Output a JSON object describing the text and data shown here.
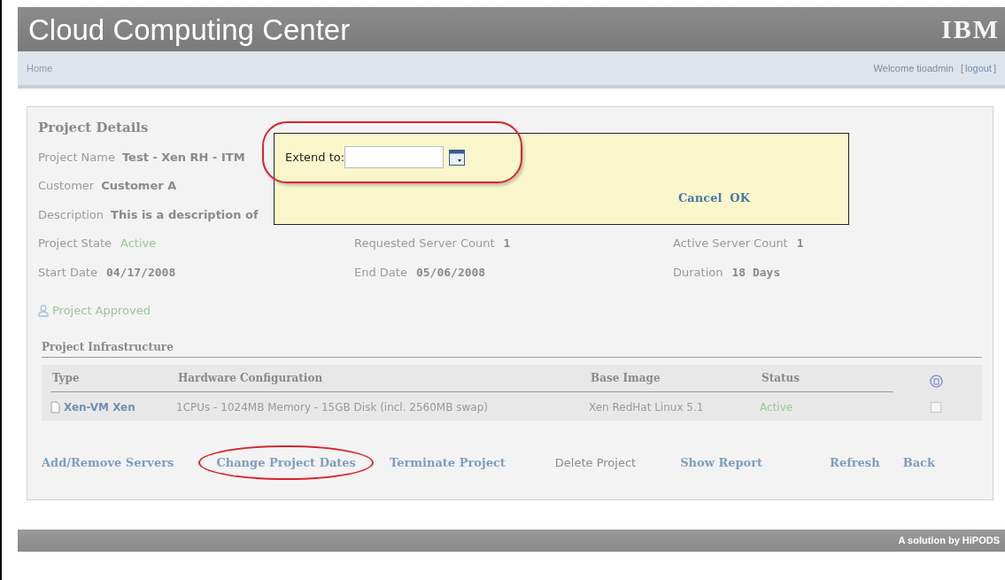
{
  "header": {
    "title": "Cloud Computing Center",
    "logo": "IBM"
  },
  "nav": {
    "home": "Home",
    "welcome": "Welcome tioadmin",
    "logout_open": "[",
    "logout": "logout",
    "logout_close": "]"
  },
  "details": {
    "heading": "Project Details",
    "fields": [
      {
        "label": "Project Name",
        "value": "Test - Xen RH - ITM"
      },
      {
        "label": "Customer",
        "value": "Customer A"
      },
      {
        "label": "Description",
        "value": "This is a description of"
      }
    ],
    "grid": [
      {
        "label": "Project State",
        "value": "Active",
        "kind": "status"
      },
      {
        "label": "Requested Server Count",
        "value": "1",
        "kind": "plain"
      },
      {
        "label": "Active Server Count",
        "value": "1",
        "kind": "plain"
      },
      {
        "label": "Start Date",
        "value": "04/17/2008",
        "kind": "plain"
      },
      {
        "label": "End Date",
        "value": "05/06/2008",
        "kind": "plain"
      },
      {
        "label": "Duration",
        "value": "18 Days",
        "kind": "plain"
      }
    ],
    "approval": "Project Approved"
  },
  "infrastructure": {
    "heading": "Project Infrastructure",
    "columns": [
      "Type",
      "Hardware Configuration",
      "Base Image",
      "Status"
    ],
    "rows": [
      {
        "type": "Xen-VM Xen",
        "hardware": "1CPUs - 1024MB Memory - 15GB Disk (incl. 2560MB swap)",
        "image": "Xen RedHat Linux 5.1",
        "status": "Active",
        "checked": false
      }
    ]
  },
  "actions": [
    {
      "label": "Add/Remove Servers",
      "disabled": false,
      "highlighted": false
    },
    {
      "label": "Change Project Dates",
      "disabled": false,
      "highlighted": true
    },
    {
      "label": "Terminate Project",
      "disabled": false,
      "highlighted": false
    },
    {
      "label": "Delete Project",
      "disabled": true,
      "highlighted": false
    },
    {
      "label": "Show Report",
      "disabled": false,
      "highlighted": false
    },
    {
      "label": "Refresh",
      "disabled": false,
      "highlighted": false
    },
    {
      "label": "Back",
      "disabled": false,
      "highlighted": false
    }
  ],
  "popup": {
    "label": "Extend to:",
    "cancel": "Cancel",
    "ok": "OK",
    "highlighted": true
  },
  "footer": "A solution by HiPODS"
}
